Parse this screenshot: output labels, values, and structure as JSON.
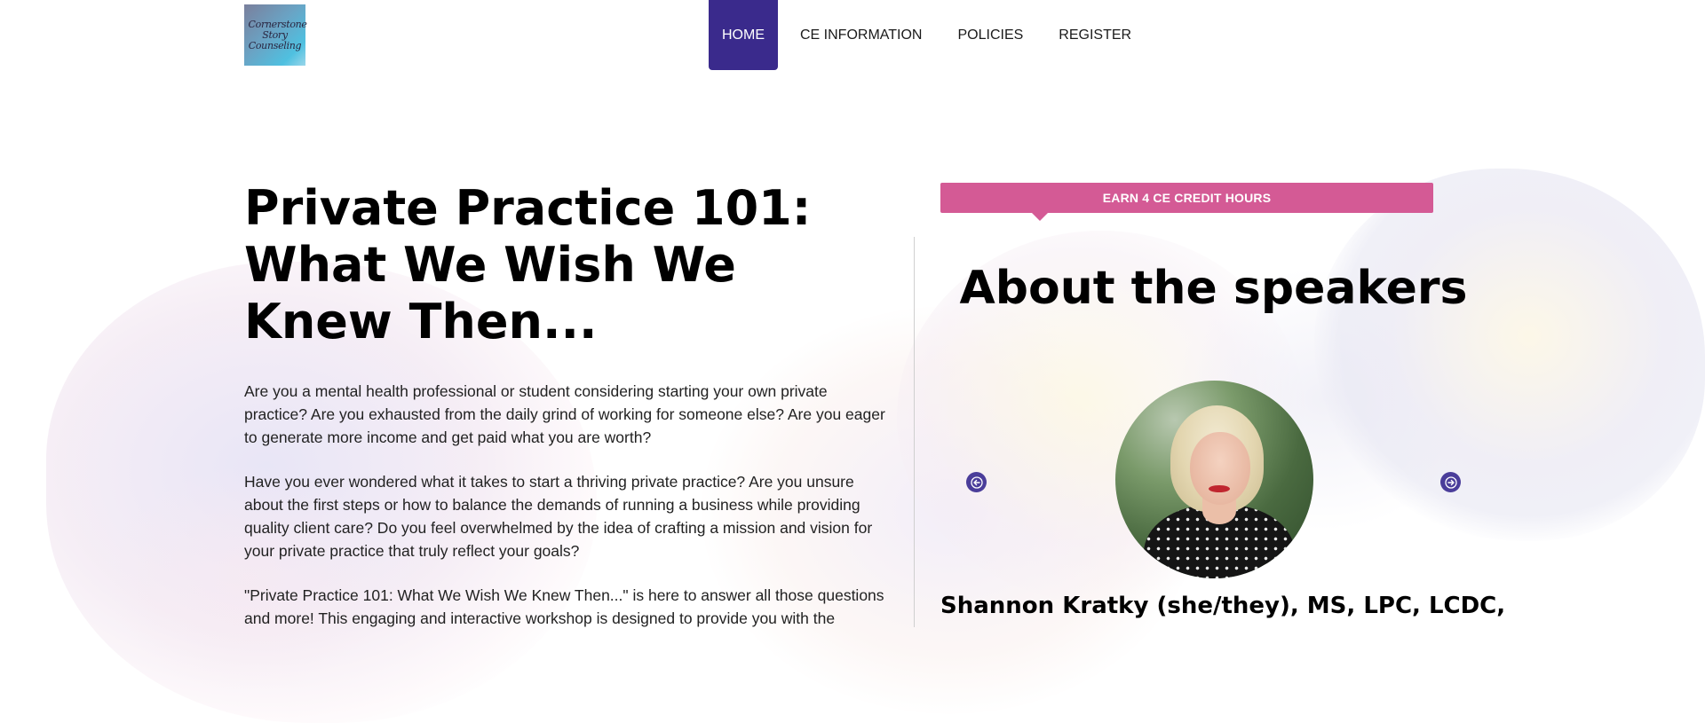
{
  "header": {
    "logo_text": "Cornerstone Story Counseling",
    "nav": [
      {
        "label": "HOME",
        "active": true
      },
      {
        "label": "CE INFORMATION",
        "active": false
      },
      {
        "label": "POLICIES",
        "active": false
      },
      {
        "label": "REGISTER",
        "active": false
      }
    ]
  },
  "main": {
    "title": "Private Practice 101: What We Wish We Knew Then...",
    "paragraphs": [
      "Are you a mental health professional or student considering starting your own private practice? Are you exhausted from the daily grind of working for someone else? Are you eager to generate more income and get paid what you are worth?",
      "Have you ever wondered what it takes to start a thriving private practice? Are you unsure about the first steps or how to balance the demands of running a business while providing quality client care? Do you feel overwhelmed by the idea of crafting a mission and vision for your private practice that truly reflect your goals?",
      "\"Private Practice 101: What We Wish We Knew Then...\" is here to answer all those questions and more! This engaging and interactive workshop is designed to provide you with the"
    ]
  },
  "sidebar": {
    "banner": "EARN 4 CE CREDIT HOURS",
    "speakers_title": "About the speakers",
    "speaker_name": "Shannon Kratky (she/they), MS, LPC, LCDC,",
    "colors": {
      "banner": "#d45a95",
      "nav_active": "#3a2a8c",
      "arrow": "#4a3d9a"
    }
  }
}
